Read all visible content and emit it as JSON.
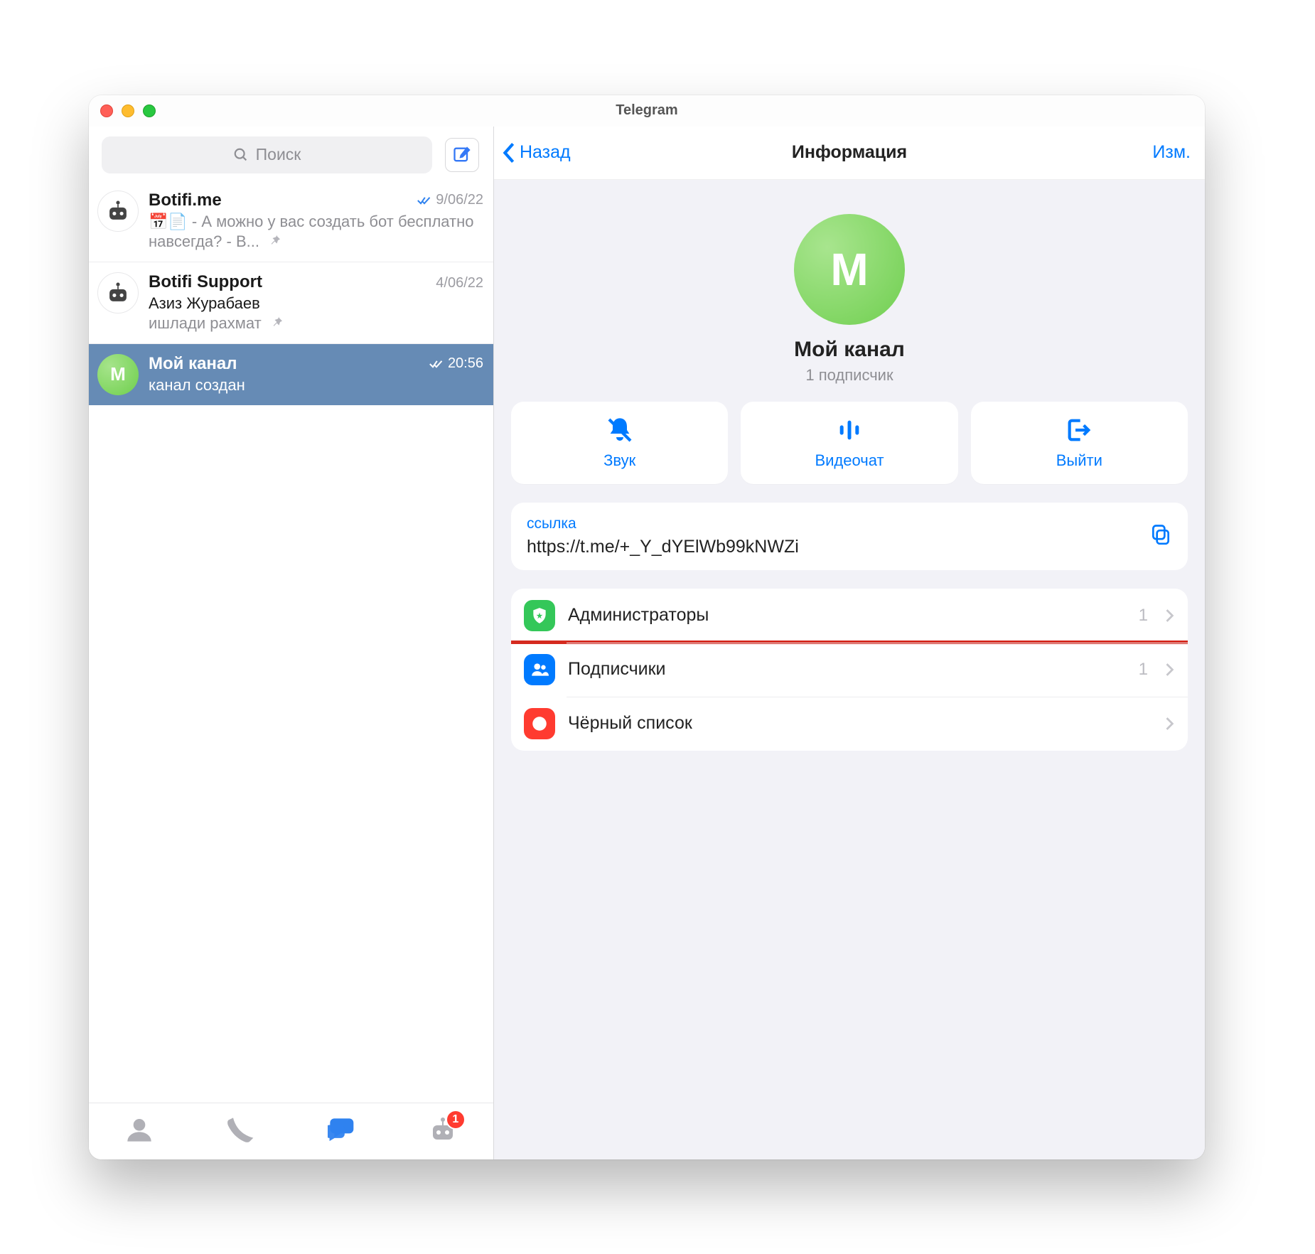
{
  "window": {
    "title": "Telegram"
  },
  "left": {
    "search_placeholder": "Поиск",
    "chats": [
      {
        "name": "Botifi.me",
        "time": "9/06/22",
        "read": true,
        "pinned": true,
        "msg_html": "📅📄 - А можно у вас создать бот бесплатно навсегда? - В..."
      },
      {
        "name": "Botifi Support",
        "time": "4/06/22",
        "read": false,
        "pinned": true,
        "from": "Азиз Журабаев",
        "msg2": "ишлади рахмат"
      },
      {
        "name": "Мой канал",
        "time": "20:56",
        "read": true,
        "active": true,
        "msg": "канал создан",
        "letter": "М"
      }
    ],
    "tabbar_badge": "1"
  },
  "right": {
    "back": "Назад",
    "title": "Информация",
    "edit": "Изм.",
    "avatar_letter": "М",
    "name": "Мой канал",
    "subtitle": "1 подписчик",
    "actions": {
      "sound": "Звук",
      "videochat": "Видеочат",
      "leave": "Выйти"
    },
    "link": {
      "label": "ссылка",
      "value": "https://t.me/+_Y_dYElWb99kNWZi"
    },
    "menu": {
      "admins": {
        "label": "Администраторы",
        "count": "1"
      },
      "subscribers": {
        "label": "Подписчики",
        "count": "1"
      },
      "blacklist": {
        "label": "Чёрный список",
        "count": ""
      }
    }
  }
}
